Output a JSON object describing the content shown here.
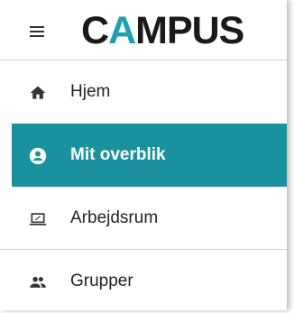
{
  "logo": {
    "part1": "C",
    "part2": "A",
    "part3": "MPUS",
    "accent_color": "#1fa0b0"
  },
  "menu_icon": "hamburger-menu-icon",
  "nav": {
    "active_color": "#1a919d",
    "items": [
      {
        "label": "Hjem",
        "icon": "home-icon",
        "active": false
      },
      {
        "label": "Mit overblik",
        "icon": "account-circle-icon",
        "active": true
      },
      {
        "label": "Arbejdsrum",
        "icon": "laptop-icon",
        "active": false
      },
      {
        "label": "Grupper",
        "icon": "group-icon",
        "active": false
      }
    ]
  }
}
